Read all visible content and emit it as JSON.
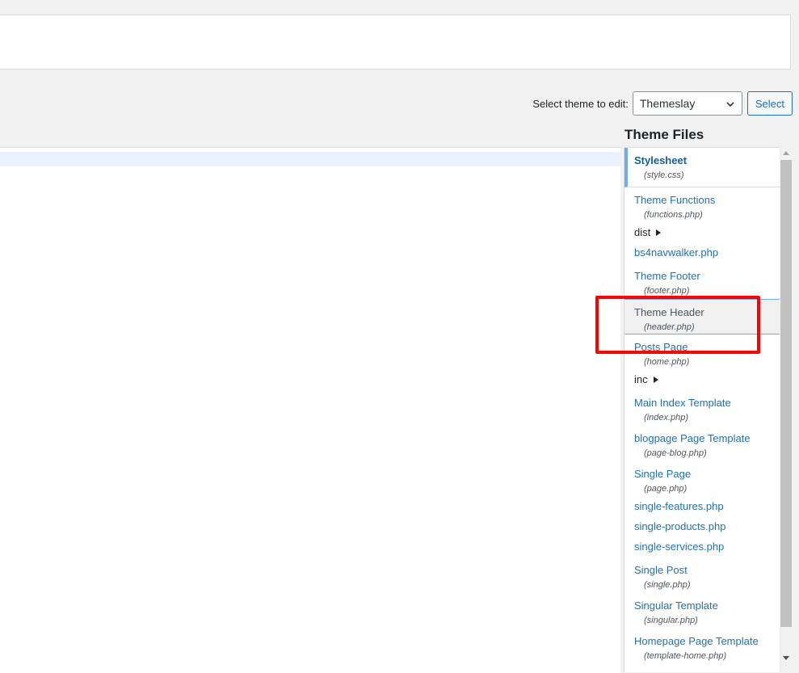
{
  "theme_selector": {
    "label": "Select theme to edit:",
    "selected": "Themeslay",
    "button_label": "Select"
  },
  "theme_files": {
    "heading": "Theme Files",
    "items": [
      {
        "name": "Stylesheet",
        "file": "(style.css)"
      },
      {
        "name": "Theme Functions",
        "file": "(functions.php)"
      },
      {
        "name": "dist"
      },
      {
        "name": "bs4navwalker.php"
      },
      {
        "name": "Theme Footer",
        "file": "(footer.php)"
      },
      {
        "name": "Theme Header",
        "file": "(header.php)"
      },
      {
        "name": "Posts Page",
        "file": "(home.php)"
      },
      {
        "name": "inc"
      },
      {
        "name": "Main Index Template",
        "file": "(index.php)"
      },
      {
        "name": "blogpage Page Template",
        "file": "(page-blog.php)"
      },
      {
        "name": "Single Page",
        "file": "(page.php)"
      },
      {
        "name": "single-features.php"
      },
      {
        "name": "single-products.php"
      },
      {
        "name": "single-services.php"
      },
      {
        "name": "Single Post",
        "file": "(single.php)"
      },
      {
        "name": "Singular Template",
        "file": "(singular.php)"
      },
      {
        "name": "Homepage Page Template",
        "file": "(template-home.php)"
      }
    ]
  },
  "colors": {
    "link": "#2271b1",
    "active_border": "#72aee6",
    "highlight": "#ff0000"
  }
}
